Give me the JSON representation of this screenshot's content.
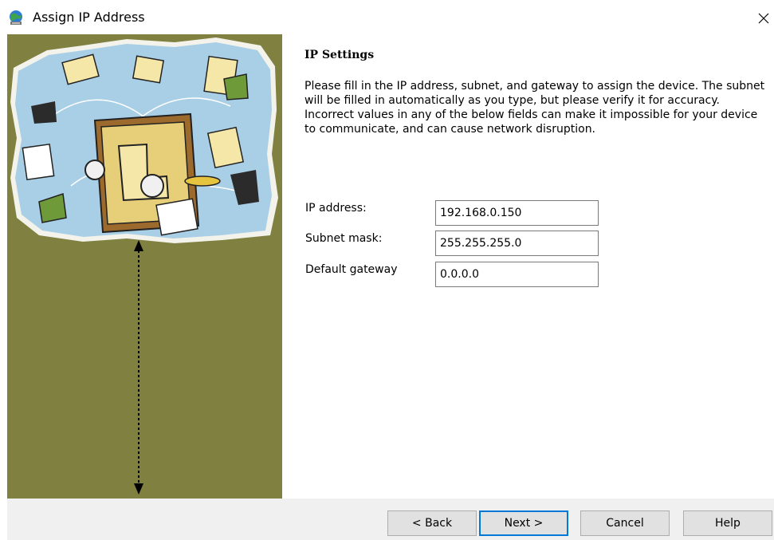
{
  "window": {
    "title": "Assign IP Address",
    "icon": "network-globe-icon",
    "close_glyph": "✕"
  },
  "content": {
    "section_title": "IP Settings",
    "description": "Please fill in the IP address, subnet, and gateway to assign the device. The subnet will be filled in automatically as you type, but please verify it for accuracy.  Incorrect values in any of the below fields can make it impossible for your device to communicate, and can cause network disruption."
  },
  "fields": {
    "ip_label": "IP address:",
    "ip_value": "192.168.0.150",
    "subnet_label": "Subnet mask:",
    "subnet_value": "255.255.255.0",
    "gateway_label": "Default gateway",
    "gateway_value": "0.0.0.0"
  },
  "buttons": {
    "back": "< Back",
    "next": "Next >",
    "cancel": "Cancel",
    "help": "Help"
  },
  "colors": {
    "art_background": "#808040",
    "map_blue": "#a9cfe6",
    "accent_focus": "#0078d7",
    "footer_bg": "#f0f0f0"
  }
}
